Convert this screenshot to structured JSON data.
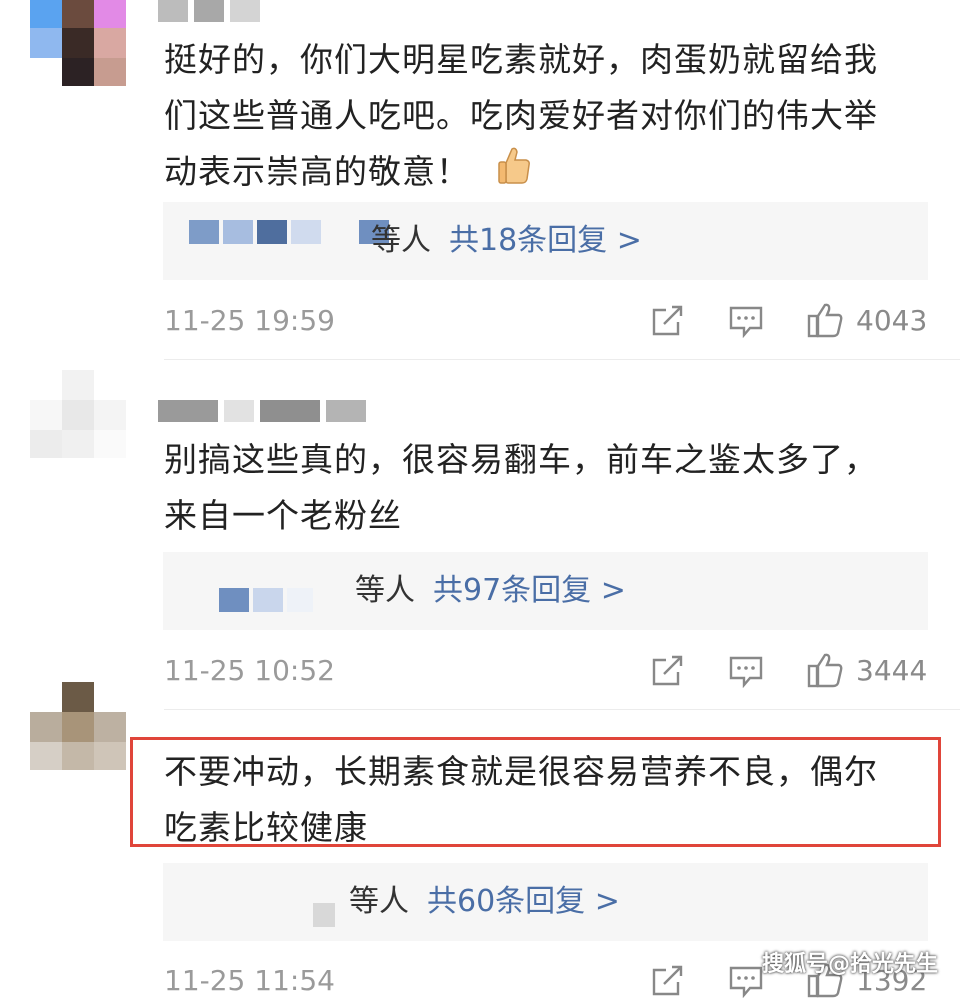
{
  "comments": [
    {
      "text_lines": [
        "挺好的，你们大明星吃素就好，肉蛋奶就留给我",
        "们这些普通人吃吧。吃肉爱好者对你们的伟大举",
        "动表示崇高的敬意！"
      ],
      "reply_who": "等人",
      "reply_link": "共18条回复 >",
      "time": "11-25 19:59",
      "likes": "4043"
    },
    {
      "text_lines": [
        "别搞这些真的，很容易翻车，前车之鉴太多了，",
        "来自一个老粉丝"
      ],
      "reply_who": "等人",
      "reply_link": "共97条回复 >",
      "time": "11-25 10:52",
      "likes": "3444"
    },
    {
      "text_lines": [
        "不要冲动，长期素食就是很容易营养不良，偶尔",
        "吃素比较健康"
      ],
      "reply_who": "等人",
      "reply_link": "共60条回复 >",
      "time": "11-25 11:54",
      "likes": "1392"
    }
  ],
  "watermark": "搜狐号@拾光先生",
  "colors": {
    "accent_link": "#4a6ea6",
    "highlight_border": "#e0453a",
    "reply_bg": "#f6f6f6"
  },
  "icons": [
    "share-icon",
    "comment-icon",
    "like-icon",
    "thumbs-up-emoji"
  ]
}
